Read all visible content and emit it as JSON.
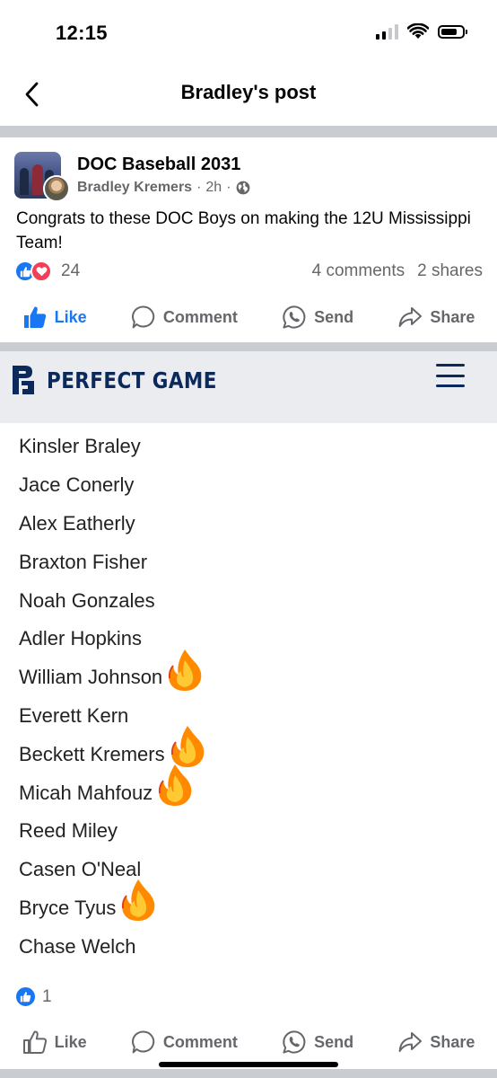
{
  "status_bar": {
    "time": "12:15"
  },
  "nav": {
    "title": "Bradley's post"
  },
  "post": {
    "group_name": "DOC Baseball 2031",
    "author": "Bradley Kremers",
    "time": "2h",
    "separator": "·",
    "text": "Congrats to these DOC Boys on making the 12U Mississippi Team!",
    "reaction_count": "24",
    "comments": "4 comments",
    "shares": "2 shares"
  },
  "actions": {
    "like": "Like",
    "comment": "Comment",
    "send": "Send",
    "share": "Share"
  },
  "shared_image": {
    "brand": "PERFECT GAME",
    "roster": [
      {
        "name": "Kinsler Braley",
        "fire": false
      },
      {
        "name": "Jace Conerly",
        "fire": false
      },
      {
        "name": "Alex Eatherly",
        "fire": false
      },
      {
        "name": "Braxton Fisher",
        "fire": false
      },
      {
        "name": "Noah Gonzales",
        "fire": false
      },
      {
        "name": "Adler Hopkins",
        "fire": false
      },
      {
        "name": "William Johnson",
        "fire": true
      },
      {
        "name": "Everett Kern",
        "fire": false
      },
      {
        "name": "Beckett Kremers",
        "fire": true
      },
      {
        "name": "Micah Mahfouz",
        "fire": true
      },
      {
        "name": "Reed Miley",
        "fire": false
      },
      {
        "name": "Casen O'Neal",
        "fire": false
      },
      {
        "name": "Bryce Tyus",
        "fire": true
      },
      {
        "name": "Chase Welch",
        "fire": false
      }
    ]
  },
  "second_item": {
    "reaction_count": "1"
  },
  "colors": {
    "facebook_blue": "#1877f2",
    "love_red": "#f33e58",
    "pg_navy": "#0b2a5b",
    "secondary_text": "#65676b",
    "fire_orange": "#ff8a00"
  },
  "icons": [
    "back-chevron-icon",
    "globe-icon",
    "like-reaction-icon",
    "love-reaction-icon",
    "like-icon",
    "comment-icon",
    "whatsapp-send-icon",
    "share-icon",
    "perfect-game-logo",
    "hamburger-menu-icon",
    "fire-emoji-icon"
  ]
}
